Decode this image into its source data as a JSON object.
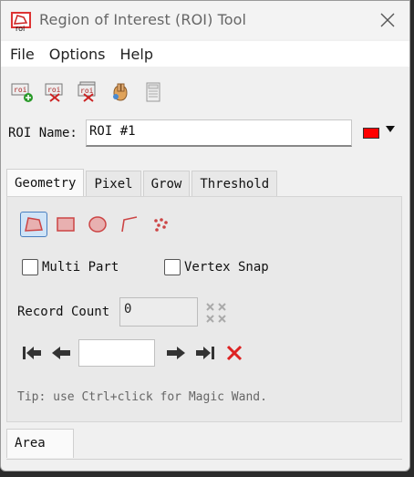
{
  "window": {
    "title": "Region of Interest (ROI) Tool",
    "app_icon_text": "roi"
  },
  "menu": [
    "File",
    "Options",
    "Help"
  ],
  "toolbar": {
    "icons": [
      "new-roi-icon",
      "delete-roi-icon",
      "delete-all-roi-icon",
      "hand-icon",
      "calculator-icon"
    ]
  },
  "roi": {
    "label": "ROI Name:",
    "value": "ROI #1",
    "color": "#ff0000"
  },
  "tabs": [
    "Geometry",
    "Pixel",
    "Grow",
    "Threshold"
  ],
  "geometry": {
    "tools": [
      "polygon-tool-icon",
      "rectangle-tool-icon",
      "ellipse-tool-icon",
      "polyline-tool-icon",
      "point-tool-icon"
    ],
    "multi_part_label": "Multi Part",
    "vertex_snap_label": "Vertex Snap",
    "record_count_label": "Record Count",
    "record_count_value": "0",
    "tip": "Tip: use Ctrl+click for Magic Wand."
  },
  "bottom_tabs": [
    "Area"
  ]
}
